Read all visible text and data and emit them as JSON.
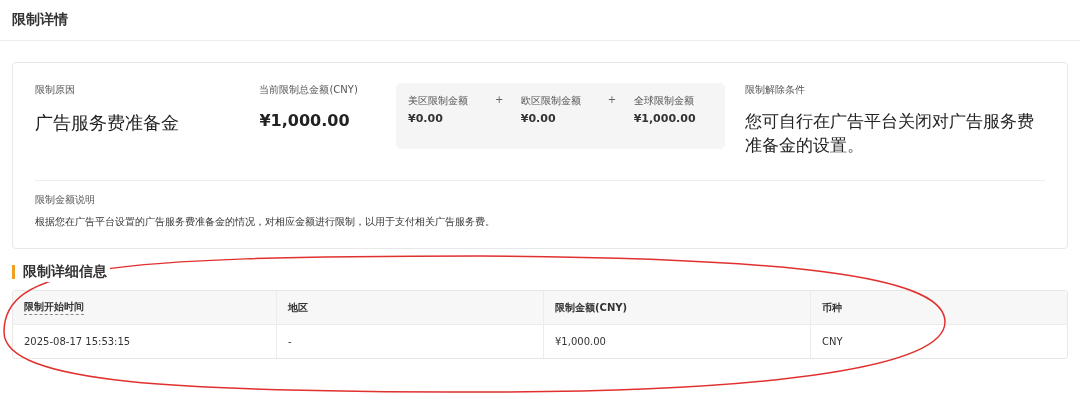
{
  "page_title": "限制详情",
  "summary": {
    "reason": {
      "label": "限制原因",
      "value": "广告服务费准备金"
    },
    "total": {
      "label": "当前限制总金额(CNY)",
      "value": "¥1,000.00"
    },
    "breakdown": [
      {
        "label": "美区限制金额",
        "value": "¥0.00"
      },
      {
        "label": "欧区限制金额",
        "value": "¥0.00"
      },
      {
        "label": "全球限制金额",
        "value": "¥1,000.00"
      }
    ],
    "breakdown_operator": "+",
    "condition": {
      "label": "限制解除条件",
      "value": "您可自行在广告平台关闭对广告服务费准备金的设置。"
    },
    "note": {
      "label": "限制金额说明",
      "text": "根据您在广告平台设置的广告服务费准备金的情况，对相应金额进行限制，以用于支付相关广告服务费。"
    }
  },
  "details": {
    "title": "限制详细信息",
    "table": {
      "columns": [
        "限制开始时间",
        "地区",
        "限制金额(CNY)",
        "币种"
      ],
      "rows": [
        [
          "2025-08-17 15:53:15",
          "-",
          "¥1,000.00",
          "CNY"
        ]
      ]
    }
  },
  "annotations": [
    {
      "kind": "ellipse"
    }
  ]
}
